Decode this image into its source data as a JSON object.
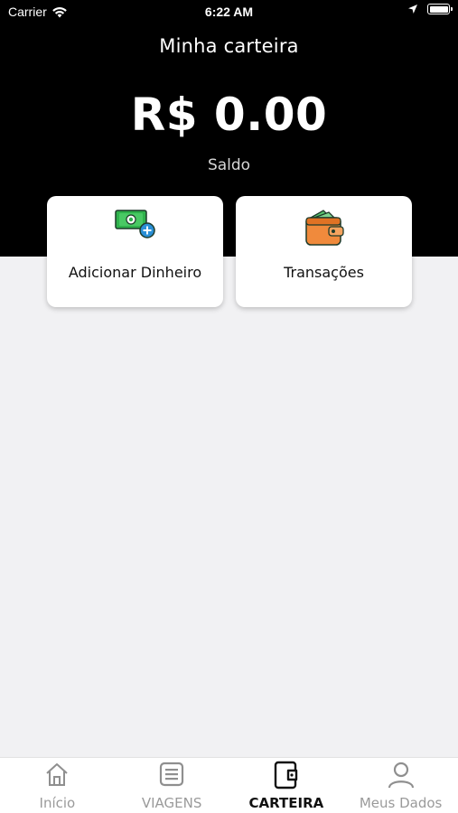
{
  "status_bar": {
    "carrier": "Carrier",
    "time": "6:22 AM"
  },
  "header": {
    "title": "Minha carteira",
    "balance": "R$ 0.00",
    "balance_label": "Saldo"
  },
  "actions": {
    "add_money": {
      "label": "Adicionar Dinheiro",
      "icon": "money-add-icon"
    },
    "transactions": {
      "label": "Transações",
      "icon": "wallet-icon"
    }
  },
  "tabs": [
    {
      "label": "Início",
      "icon": "home-icon",
      "active": false
    },
    {
      "label": "VIAGENS",
      "icon": "list-icon",
      "active": false
    },
    {
      "label": "CARTEIRA",
      "icon": "wallet-icon",
      "active": true
    },
    {
      "label": "Meus Dados",
      "icon": "user-icon",
      "active": false
    }
  ],
  "colors": {
    "header_bg": "#000000",
    "page_bg": "#f1f1f3",
    "active_tab": "#111111",
    "inactive_tab": "#9a9a9a"
  }
}
